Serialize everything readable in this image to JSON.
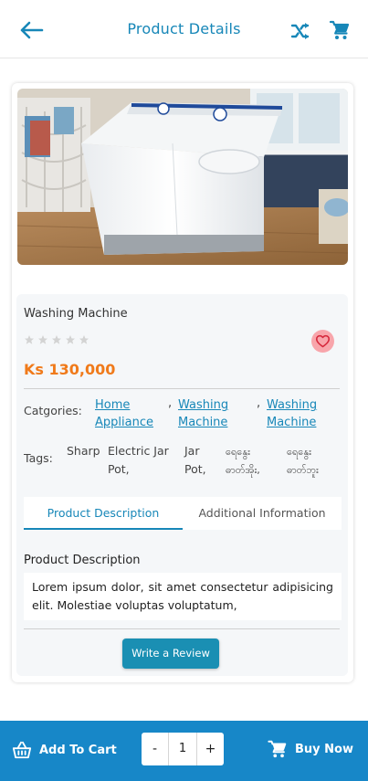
{
  "header": {
    "title": "Product Details",
    "back_icon": "arrow-left-icon",
    "shuffle_icon": "shuffle-icon",
    "cart_icon": "cart-icon"
  },
  "product": {
    "name": "Washing Machine",
    "rating": 0,
    "rating_max": 5,
    "price": "Ks 130,000",
    "image_alt": "white twin-tub washing machine"
  },
  "categories": {
    "label": "Catgories:",
    "items": [
      {
        "line1": "Home",
        "line2": "Appliance"
      },
      {
        "line1": "Washing",
        "line2": "Machine"
      },
      {
        "line1": "Washing",
        "line2": "Machine"
      }
    ],
    "separator": ","
  },
  "tags": {
    "label": "Tags:",
    "items": [
      {
        "line1": "Sharp",
        "line2": ""
      },
      {
        "line1": "Electric Jar",
        "line2": "Pot,"
      },
      {
        "line1": "Jar",
        "line2": "Pot,"
      },
      {
        "line1": "ရေနွေး",
        "line2": "ဓာတ်အိုး,"
      },
      {
        "line1": "ရေနွေး",
        "line2": "ဓာတ်ဘူး"
      }
    ]
  },
  "tabs": [
    {
      "label": "Product Description",
      "active": true
    },
    {
      "label": "Additional Information",
      "active": false
    }
  ],
  "description": {
    "heading": "Product Description",
    "text": "Lorem ipsum dolor, sit amet consectetur adipisicing elit. Molestiae voluptas voluptatum,"
  },
  "review_button": "Write a Review",
  "bottom_bar": {
    "add_to_cart": "Add To Cart",
    "qty_minus": "-",
    "qty_value": "1",
    "qty_plus": "+",
    "buy_now": "Buy Now"
  },
  "colors": {
    "accent": "#1787b8",
    "price": "#f07a1a",
    "bottom_bar": "#1787c8",
    "favorite": "#f8a5ab"
  }
}
